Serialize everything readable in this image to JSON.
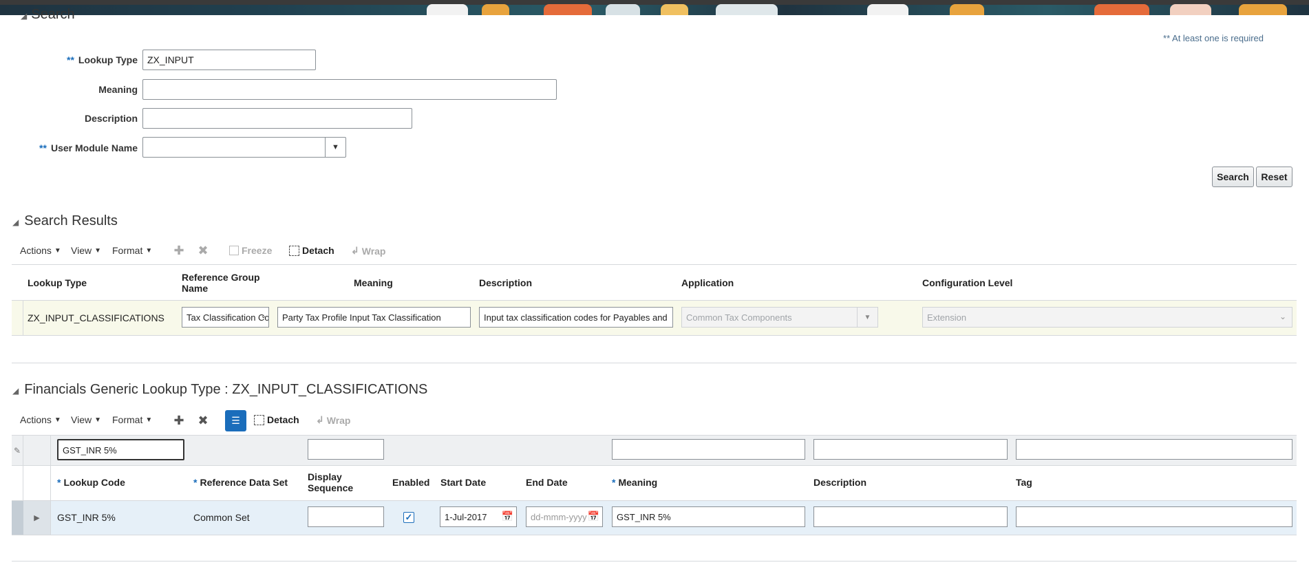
{
  "search": {
    "title": "Search",
    "required_note": "** At least one is required",
    "req_mark": "**",
    "fields": {
      "lookup_type": {
        "label": "Lookup Type",
        "value": "ZX_INPUT"
      },
      "meaning": {
        "label": "Meaning",
        "value": ""
      },
      "description": {
        "label": "Description",
        "value": ""
      },
      "user_module": {
        "label": "User Module Name",
        "value": ""
      }
    },
    "search_button": "Search",
    "reset_button": "Reset"
  },
  "results": {
    "title": "Search Results",
    "toolbar": {
      "actions": "Actions",
      "view": "View",
      "format": "Format",
      "freeze": "Freeze",
      "detach": "Detach",
      "wrap": "Wrap"
    },
    "columns": {
      "lookup_type": "Lookup Type",
      "ref_group": "Reference Group Name",
      "meaning": "Meaning",
      "description": "Description",
      "application": "Application",
      "config_level": "Configuration Level"
    },
    "row": {
      "lookup_type": "ZX_INPUT_CLASSIFICATIONS",
      "ref_group": "Tax Classification Co",
      "meaning": "Party Tax Profile Input Tax Classification",
      "description": "Input tax classification codes for Payables and",
      "application": "Common Tax Components",
      "config_level": "Extension"
    }
  },
  "lookup": {
    "title": "Financials Generic Lookup Type : ZX_INPUT_CLASSIFICATIONS",
    "toolbar": {
      "actions": "Actions",
      "view": "View",
      "format": "Format",
      "detach": "Detach",
      "wrap": "Wrap"
    },
    "filter": {
      "lookup_code": "GST_INR 5%"
    },
    "columns": {
      "lookup_code": "Lookup Code",
      "ref_data_set": "Reference Data Set",
      "display_sequence": "Display Sequence",
      "enabled": "Enabled",
      "start_date": "Start Date",
      "end_date": "End Date",
      "meaning": "Meaning",
      "description": "Description",
      "tag": "Tag"
    },
    "required_star": "*",
    "row": {
      "lookup_code": "GST_INR 5%",
      "ref_data_set": "Common Set",
      "display_sequence": "",
      "enabled": true,
      "start_date": "1-Jul-2017",
      "end_date_placeholder": "dd-mmm-yyyy",
      "meaning": "GST_INR 5%",
      "description": "",
      "tag": ""
    }
  },
  "colors": {
    "accent": "#1a6dbb",
    "selected_row": "#e6f0f8",
    "result_row": "#f8f9ea"
  }
}
